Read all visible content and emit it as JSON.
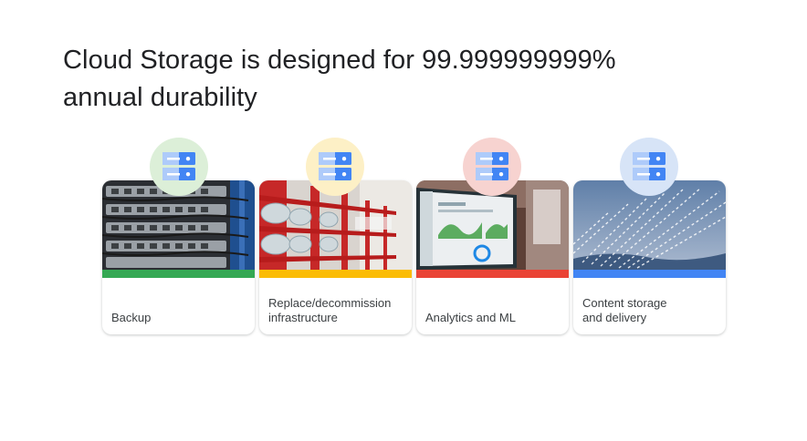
{
  "slide": {
    "title_line1": "Cloud Storage is designed for 99.999999999%",
    "title_line2": "annual durability"
  },
  "cards": [
    {
      "label_line1": "",
      "label_line2": "Backup",
      "accent_color": "#34a853",
      "badge_color": "#dcefd8",
      "image": "server-rack-photo"
    },
    {
      "label_line1": "Replace/decommission",
      "label_line2": "infrastructure",
      "accent_color": "#fbbc04",
      "badge_color": "#fdf0c6",
      "image": "red-storage-shelves-photo"
    },
    {
      "label_line1": "",
      "label_line2": "Analytics and ML",
      "accent_color": "#ea4335",
      "badge_color": "#f7d3d0",
      "image": "laptop-dashboard-photo"
    },
    {
      "label_line1": "Content storage",
      "label_line2": "and delivery",
      "accent_color": "#4285f4",
      "badge_color": "#d7e4f7",
      "image": "data-stream-sky-photo"
    }
  ],
  "icon": {
    "name": "cloud-storage-icon",
    "color_dark": "#4285f4",
    "color_light": "#aecbfa"
  }
}
